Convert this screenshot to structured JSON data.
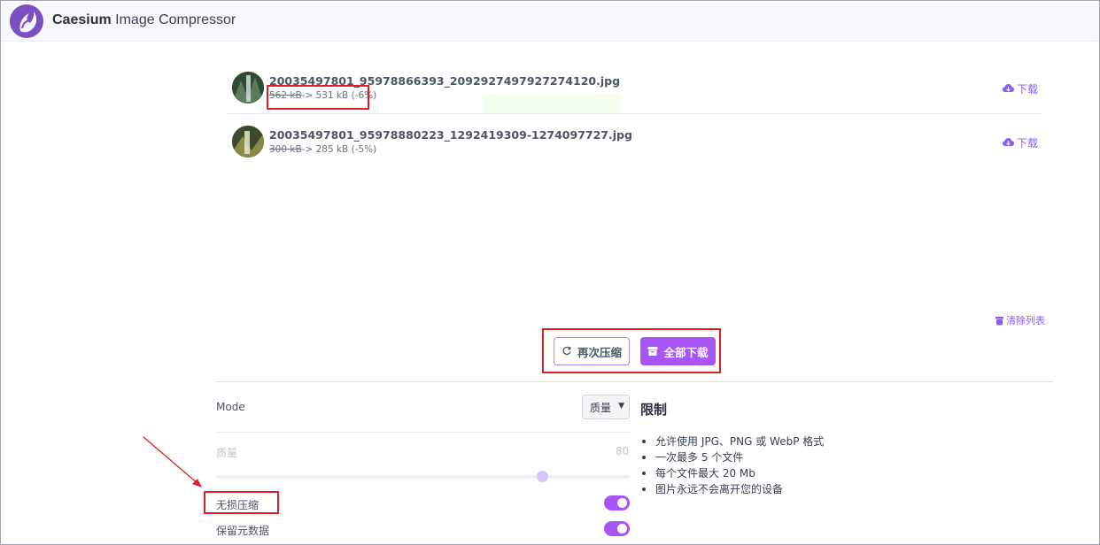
{
  "app": {
    "brand_bold": "Caesium",
    "brand_rest": " Image Compressor"
  },
  "files": [
    {
      "name": "20035497801_95978866393_2092927497927274120.jpg",
      "old_size": "562 kB",
      "new_size": "-> 531 kB (-6%)",
      "download_label": "下载"
    },
    {
      "name": "20035497801_95978880223_1292419309-1274097727.jpg",
      "old_size": "300 kB",
      "new_size": "-> 285 kB (-5%)",
      "download_label": "下载"
    }
  ],
  "clear_list_label": "清除列表",
  "actions": {
    "recompress_label": "再次压缩",
    "download_all_label": "全部下载"
  },
  "settings": {
    "mode_label": "Mode",
    "mode_value": "质量",
    "quality_label": "质量",
    "quality_value": "80",
    "lossless_label": "无损压缩",
    "keep_metadata_label": "保留元数据"
  },
  "limits": {
    "title": "限制",
    "items": [
      "允许使用 JPG、PNG 或 WebP 格式",
      "一次最多 5 个文件",
      "每个文件最大 20 Mb",
      "图片永远不会离开您的设备"
    ]
  },
  "colors": {
    "accent": "#a855f7",
    "highlight_box": "#e11d2a"
  }
}
